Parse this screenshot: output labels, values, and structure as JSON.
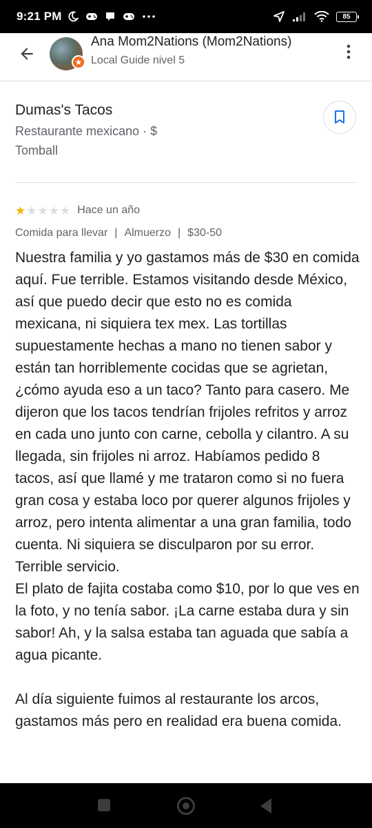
{
  "status_bar": {
    "time": "9:21 PM",
    "battery": "85"
  },
  "header": {
    "reviewer_name": "Ana Mom2Nations (Mom2Nations)",
    "reviewer_level": "Local Guide nivel 5"
  },
  "place": {
    "name": "Dumas's Tacos",
    "type": "Restaurante mexicano · $",
    "city": "Tomball"
  },
  "review": {
    "rating": 1,
    "max_rating": 5,
    "time": "Hace un año",
    "meta": {
      "service": "Comida para llevar",
      "meal": "Almuerzo",
      "price": "$30-50",
      "separator": "|"
    },
    "paragraph_1": "Nuestra familia y yo gastamos más de $30 en comida aquí. Fue terrible. Estamos visitando desde México, así que puedo decir que esto no es comida mexicana, ni siquiera tex mex. Las tortillas supuestamente hechas a mano no tienen sabor y están tan horriblemente cocidas que se agrietan, ¿cómo ayuda eso a un taco? Tanto para casero. Me dijeron que los tacos tendrían frijoles refritos y arroz en cada uno junto con carne, cebolla y cilantro. A su llegada, sin frijoles ni arroz. Habíamos pedido 8 tacos, así que llamé y me trataron como si no fuera gran cosa y estaba loco por querer algunos frijoles y arroz, pero intenta alimentar a una gran familia, todo cuenta. Ni siquiera se disculparon por su error. Terrible servicio.",
    "paragraph_2": "El plato de fajita costaba como $10, por lo que ves en la foto, y no tenía sabor. ¡La carne estaba dura y sin sabor! Ah, y la salsa estaba tan aguada que sabía a agua picante.",
    "paragraph_3": "Al día siguiente fuimos al restaurante los arcos, gastamos más pero en realidad era buena comida."
  },
  "colors": {
    "star_filled": "#f5b400",
    "star_empty": "#dadce0",
    "accent": "#1a73e8",
    "badge": "#f26b1d"
  }
}
